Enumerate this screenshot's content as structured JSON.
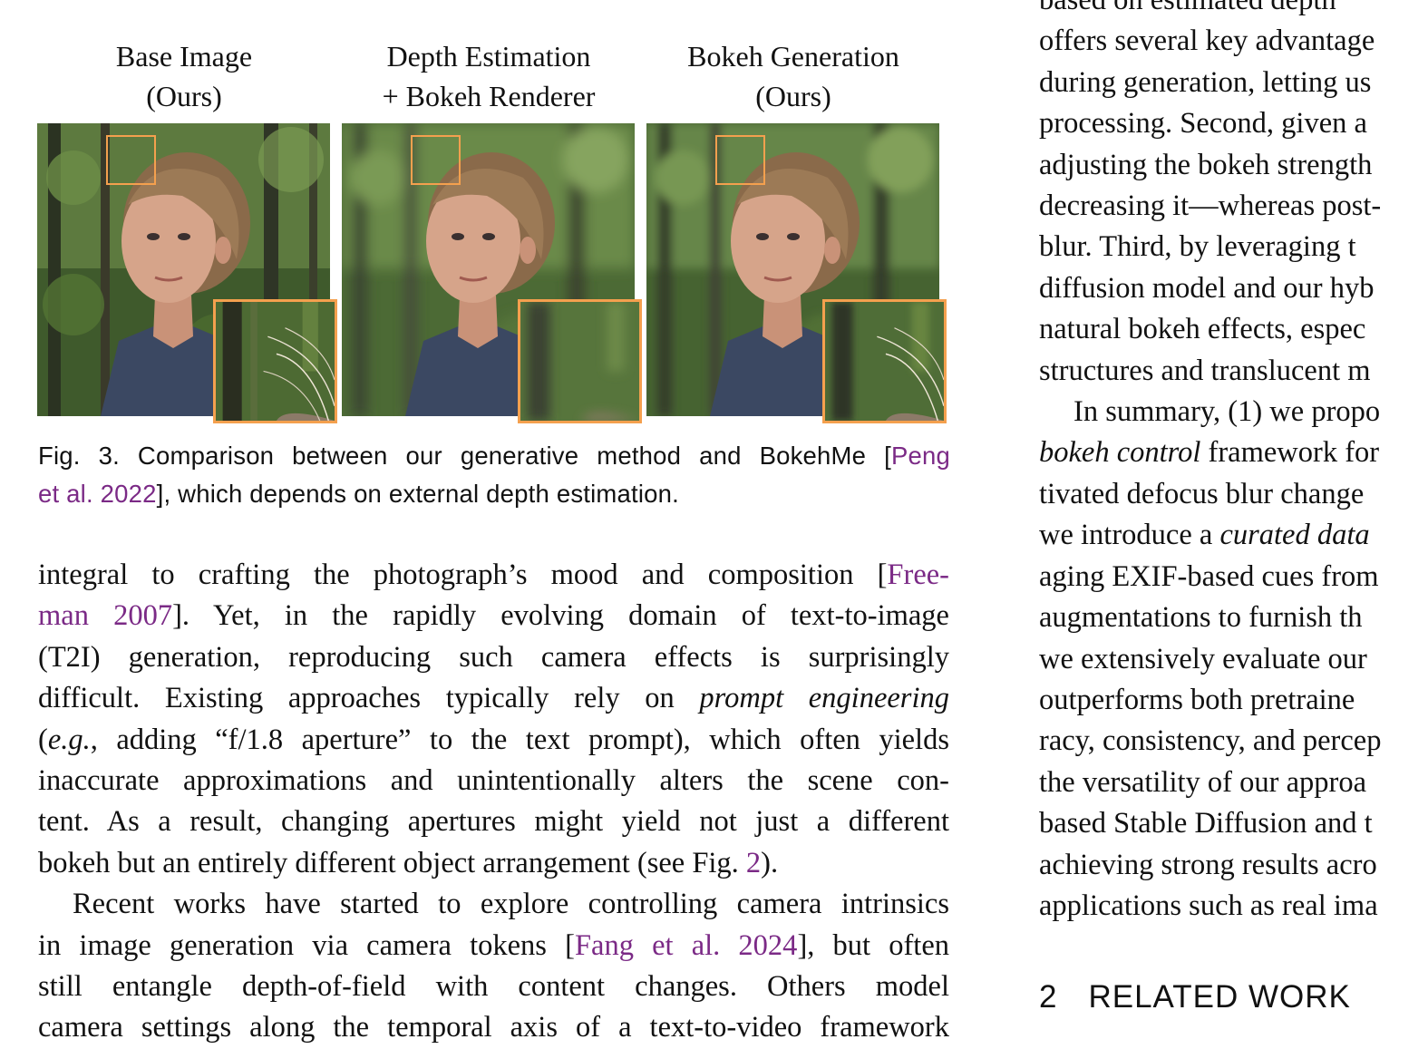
{
  "figure": {
    "columns": [
      {
        "title_line1": "Base Image",
        "title_line2": "(Ours)"
      },
      {
        "title_line1": "Depth Estimation",
        "title_line2": "+ Bokeh Renderer"
      },
      {
        "title_line1": "Bokeh Generation",
        "title_line2": "(Ours)"
      }
    ],
    "caption": {
      "label": "Fig. 3.",
      "text_before": "Comparison between our generative method and BokehMe [",
      "cite": "Peng et al. 2022",
      "text_after": "], which depends on external depth estimation.",
      "line1_pre": "Fig. 3.  Comparison between our generative method and BokehMe [",
      "line1_cite": "Peng",
      "line2_cite": "et al. 2022",
      "line2_post": "], which depends on external depth estimation."
    },
    "colors": {
      "highlight_box": "#f4a04e",
      "citation": "#7b2a86"
    }
  },
  "left_column": {
    "lines": [
      {
        "pre": "integral to crafting the photograph’s mood and composition [",
        "cite": "Free-"
      },
      {
        "cite": "man 2007",
        "post": "]. Yet, in the rapidly evolving domain of text-to-image"
      },
      {
        "pre": "(T2I) generation, reproducing such camera effects is surprisingly"
      },
      {
        "pre": "difficult. Existing approaches typically rely on ",
        "em": "prompt engineering"
      },
      {
        "pre": "(",
        "em": "e.g.",
        "post": ", adding “f/1.8 aperture” to the text prompt), which often yields"
      },
      {
        "pre": "inaccurate approximations and unintentionally alters the scene con-"
      },
      {
        "pre": "tent. As a result, changing apertures might yield not just a different"
      },
      {
        "pre": "bokeh but an entirely different object arrangement (see Fig. ",
        "cite": "2",
        "post": ")."
      },
      {
        "pre": "Recent works have started to explore controlling camera intrinsics"
      },
      {
        "pre": "in image generation via camera tokens [",
        "cite": "Fang et al. 2024",
        "post": "], but often"
      },
      {
        "pre": "still entangle depth-of-field with content changes. Others model"
      },
      {
        "pre": "camera settings along the temporal axis of a text-to-video framework"
      }
    ]
  },
  "right_column": {
    "lines": [
      {
        "pre": "based on estimated depth"
      },
      {
        "pre": "offers several key advantage"
      },
      {
        "pre": "during generation, letting us"
      },
      {
        "pre": "processing. Second, given a"
      },
      {
        "pre": "adjusting the bokeh strength"
      },
      {
        "pre": "decreasing it—whereas post-"
      },
      {
        "pre": "blur. Third, by leveraging t"
      },
      {
        "pre": "diffusion model and our hyb"
      },
      {
        "pre": "natural bokeh effects, espec"
      },
      {
        "pre": "structures and translucent m"
      },
      {
        "pre": "In summary, (1) we propo"
      },
      {
        "em": "bokeh control",
        "post": " framework for"
      },
      {
        "pre": "tivated defocus blur change"
      },
      {
        "pre": "we introduce a ",
        "em": "curated data"
      },
      {
        "pre": "aging EXIF-based cues from"
      },
      {
        "pre": "augmentations to furnish th"
      },
      {
        "pre": "we extensively evaluate our"
      },
      {
        "pre": "outperforms both pretraine"
      },
      {
        "pre": "racy, consistency, and percep"
      },
      {
        "pre": "the versatility of our approa"
      },
      {
        "pre": "based Stable Diffusion and t"
      },
      {
        "pre": "achieving strong results acro"
      },
      {
        "pre": "applications such as real ima"
      }
    ],
    "section": {
      "number": "2",
      "title": "RELATED WORK"
    }
  }
}
